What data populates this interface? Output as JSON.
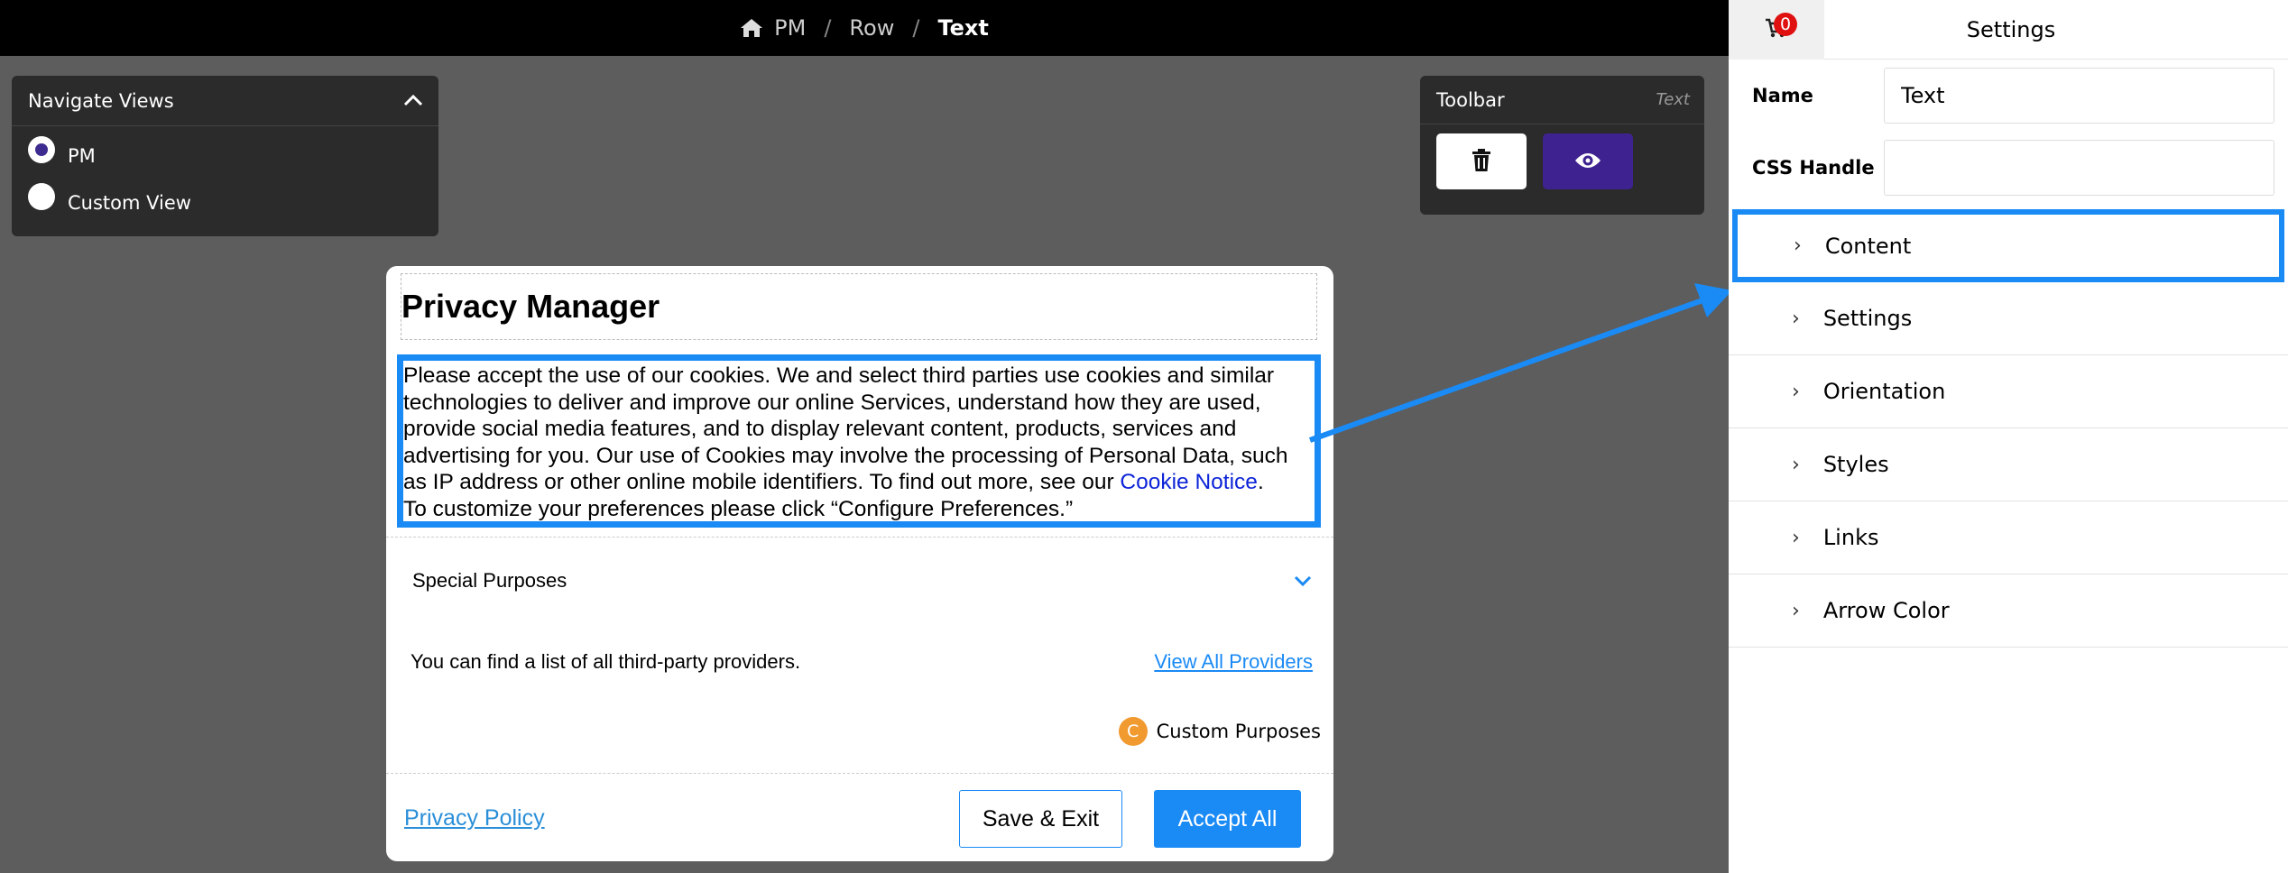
{
  "breadcrumb": {
    "items": [
      "PM",
      "Row",
      "Text"
    ],
    "separator": "/"
  },
  "nav_panel": {
    "title": "Navigate Views",
    "options": [
      {
        "label": "PM",
        "selected": true
      },
      {
        "label": "Custom View",
        "selected": false
      }
    ]
  },
  "toolbar_panel": {
    "title": "Toolbar",
    "tag": "Text"
  },
  "dialog": {
    "title": "Privacy Manager",
    "body_text": "Please accept the use of our cookies. We and select third parties use cookies and similar technologies to deliver and improve our online Services, understand how they are used, provide social media features, and to display relevant content, products, services and advertising for you. Our use of Cookies may involve the processing of Personal Data, such as IP address or other online mobile identifiers. To find out more, see our ",
    "cookie_link": "Cookie Notice",
    "body_end": ".",
    "body_line2": "To customize your preferences please click “Configure Preferences.”",
    "special_purposes": "Special Purposes",
    "providers_text": "You can find a list of all third-party providers.",
    "providers_link": "View All Providers",
    "custom_badge": "C",
    "custom_purposes": "Custom Purposes",
    "privacy_policy": "Privacy Policy",
    "save_exit": "Save & Exit",
    "accept_all": "Accept All"
  },
  "settings": {
    "badge_count": "0",
    "heading": "Settings",
    "name_label": "Name",
    "name_value": "Text",
    "css_label": "CSS Handle",
    "css_value": "",
    "sections": [
      "Content",
      "Settings",
      "Orientation",
      "Styles",
      "Links",
      "Arrow Color"
    ],
    "highlighted_section": "Content"
  },
  "colors": {
    "accent": "#1a8af5",
    "purple": "#3d2290",
    "badge": "#e01010",
    "custom_badge": "#f19a30"
  }
}
